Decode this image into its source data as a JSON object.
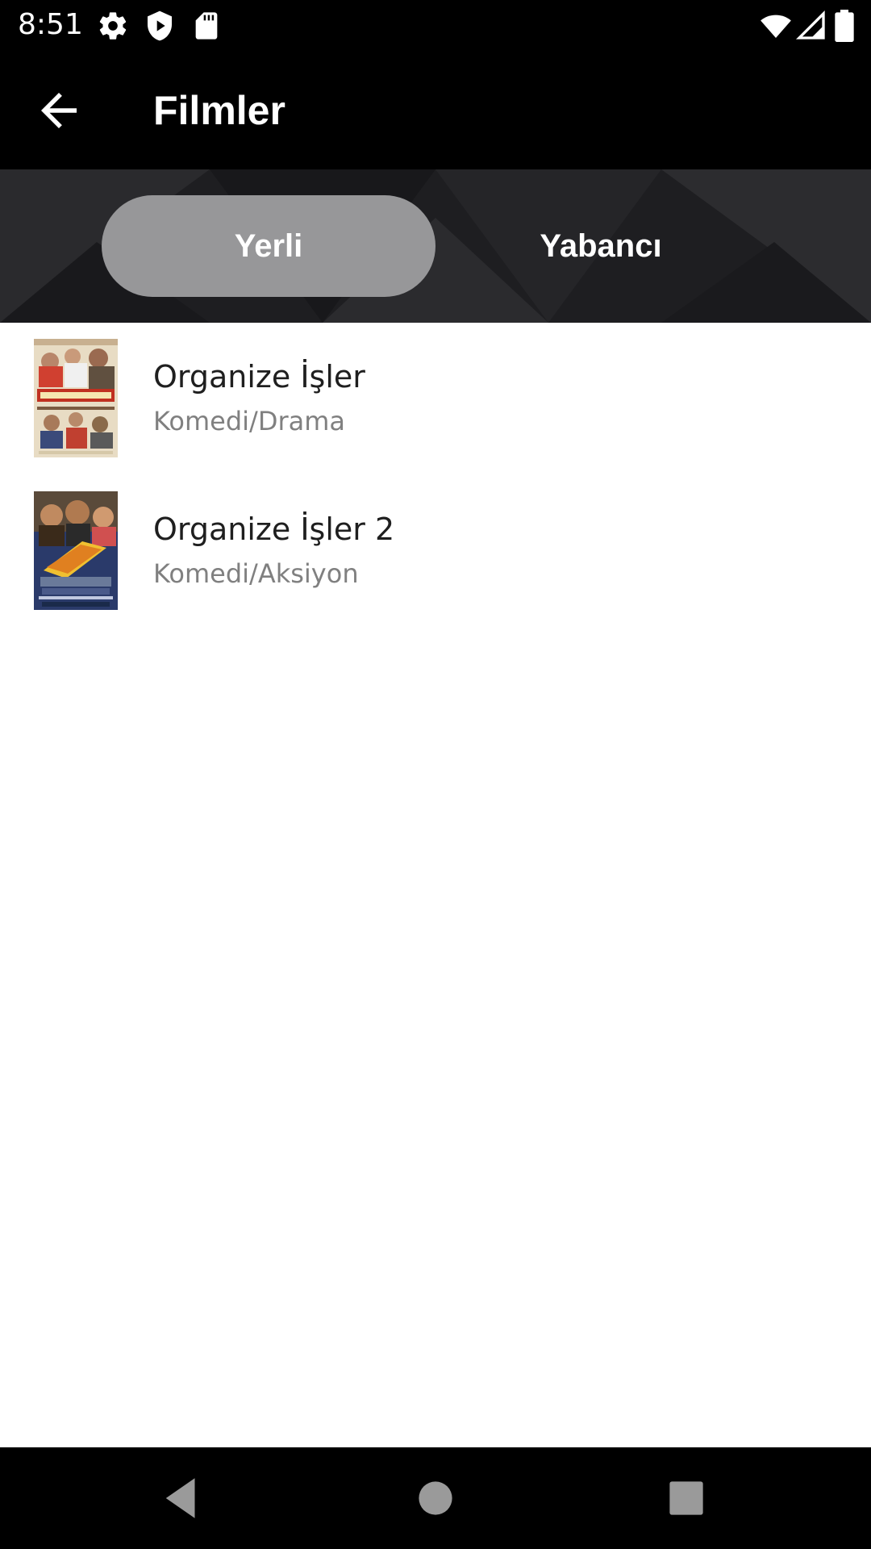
{
  "status_bar": {
    "time": "8:51",
    "left_icons": [
      "gear-icon",
      "shield-play-icon",
      "sd-card-icon"
    ],
    "right_icons": [
      "wifi-icon",
      "signal-icon",
      "battery-icon"
    ]
  },
  "app_bar": {
    "title": "Filmler",
    "back_icon": "arrow-left-icon"
  },
  "tabs": [
    {
      "label": "Yerli",
      "selected": true
    },
    {
      "label": "Yabancı",
      "selected": false
    }
  ],
  "movies": [
    {
      "title": "Organize İşler",
      "genre": "Komedi/Drama"
    },
    {
      "title": "Organize İşler 2",
      "genre": "Komedi/Aksiyon"
    }
  ],
  "nav_bar": {
    "icons": [
      "back-triangle-icon",
      "home-circle-icon",
      "recents-square-icon"
    ]
  },
  "colors": {
    "app_bar_bg": "#000000",
    "tab_header_bg": "#1e1e21",
    "tab_selected_bg": "#979799",
    "title_text": "#1f1f1f",
    "subtitle_text": "#808080"
  }
}
